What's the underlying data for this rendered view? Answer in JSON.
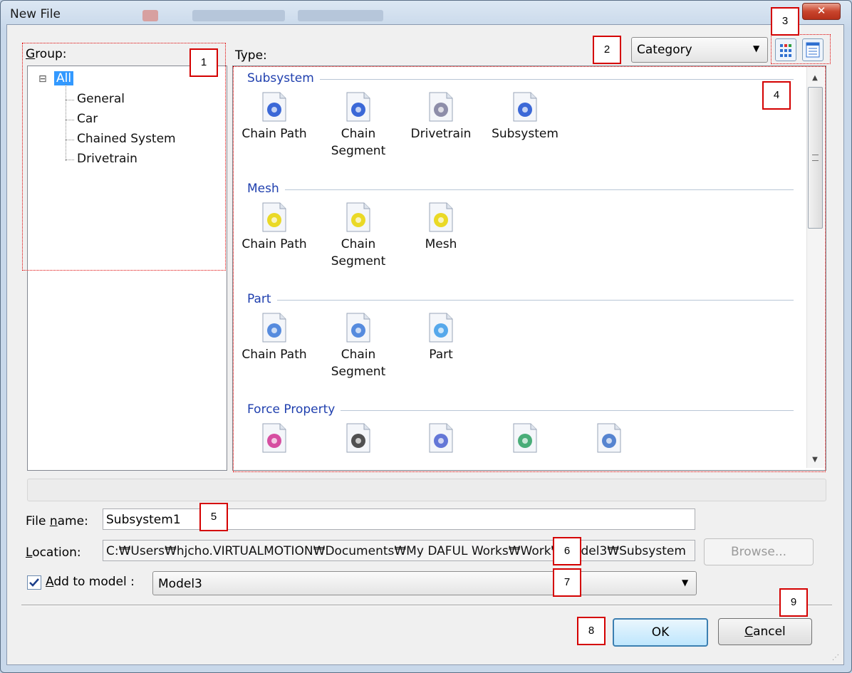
{
  "window": {
    "title": "New File",
    "close_glyph": "✕"
  },
  "group": {
    "label": "Group:",
    "label_underline": "G",
    "label_rest": "roup:",
    "expander": "⊟",
    "items": [
      "All",
      "General",
      "Car",
      "Chained System",
      "Drivetrain"
    ]
  },
  "type": {
    "label": "Type:",
    "view_mode": "Category",
    "sections": [
      {
        "name": "Subsystem",
        "items": [
          {
            "label": [
              "Chain Path"
            ],
            "icon": "chain-path-subsystem-icon",
            "color": "#1a4fd0"
          },
          {
            "label": [
              "Chain",
              "Segment"
            ],
            "icon": "chain-segment-subsystem-icon",
            "color": "#1a4fd0"
          },
          {
            "label": [
              "Drivetrain"
            ],
            "icon": "drivetrain-icon",
            "color": "#7a7a9a"
          },
          {
            "label": [
              "Subsystem"
            ],
            "icon": "subsystem-icon",
            "color": "#1a4fd0"
          }
        ]
      },
      {
        "name": "Mesh",
        "items": [
          {
            "label": [
              "Chain Path"
            ],
            "icon": "chain-path-mesh-icon",
            "color": "#e8d400"
          },
          {
            "label": [
              "Chain",
              "Segment"
            ],
            "icon": "chain-segment-mesh-icon",
            "color": "#e8d400"
          },
          {
            "label": [
              "Mesh"
            ],
            "icon": "mesh-icon",
            "color": "#e8d400"
          }
        ]
      },
      {
        "name": "Part",
        "items": [
          {
            "label": [
              "Chain Path"
            ],
            "icon": "chain-path-part-icon",
            "color": "#3a78d8"
          },
          {
            "label": [
              "Chain",
              "Segment"
            ],
            "icon": "chain-segment-part-icon",
            "color": "#3a78d8"
          },
          {
            "label": [
              "Part"
            ],
            "icon": "part-icon",
            "color": "#3a9ae8"
          }
        ]
      },
      {
        "name": "Force Property",
        "items": [
          {
            "label": [
              ""
            ],
            "icon": "force-spring-icon",
            "color": "#d03090"
          },
          {
            "label": [
              ""
            ],
            "icon": "tire-icon",
            "color": "#333333"
          },
          {
            "label": [
              ""
            ],
            "icon": "spring-icon",
            "color": "#4a60d0"
          },
          {
            "label": [
              ""
            ],
            "icon": "damper-icon",
            "color": "#2aa060"
          },
          {
            "label": [
              ""
            ],
            "icon": "car-spring-icon",
            "color": "#3a70c8"
          }
        ]
      }
    ]
  },
  "form": {
    "file_name_label": "File name:",
    "file_name_pre": "File ",
    "file_name_u": "n",
    "file_name_post": "ame:",
    "file_name_value": "Subsystem1",
    "location_label": "Location:",
    "location_u": "L",
    "location_post": "ocation:",
    "location_value": "C:₩Users₩hjcho.VIRTUALMOTION₩Documents₩My DAFUL Works₩Work₩Model3₩Subsystem",
    "browse_label": "Browse...",
    "add_to_model_label": "Add to model :",
    "add_u": "A",
    "add_post": "dd to model :",
    "add_checked": true,
    "model_value": "Model3"
  },
  "buttons": {
    "ok": "OK",
    "cancel": "Cancel",
    "cancel_u": "C",
    "cancel_post": "ancel"
  },
  "callouts": [
    "1",
    "2",
    "3",
    "4",
    "5",
    "6",
    "7",
    "8",
    "9"
  ],
  "colors": {
    "accent": "#3399ff",
    "section_text": "#1f3fae",
    "callout_border": "#d40000"
  }
}
